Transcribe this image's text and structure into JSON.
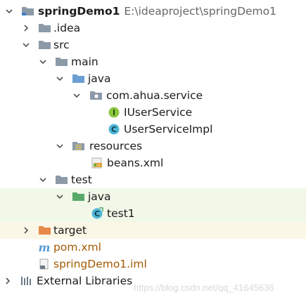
{
  "tree": {
    "project": {
      "name": "springDemo1",
      "path": "E:\\ideaproject\\springDemo1"
    },
    "idea": ".idea",
    "src": "src",
    "main": "main",
    "main_java": "java",
    "package": "com.ahua.service",
    "iuserservice": "IUserService",
    "userserviceimpl": "UserServiceImpl",
    "resources": "resources",
    "beans": "beans.xml",
    "test": "test",
    "test_java": "java",
    "test1": "test1",
    "target": "target",
    "pom": "pom.xml",
    "iml": "springDemo1.iml",
    "external": "External Libraries"
  },
  "watermark": "https://blog.csdn.net/qq_41645636",
  "colors": {
    "folder": "#8c9aa8",
    "source_folder": "#6a9fd1",
    "test_folder": "#59a869",
    "target_folder": "#e8894a",
    "interface_icon": "#8cc63f",
    "class_icon": "#50b6d6",
    "test_row_bg": "#f1f8e8",
    "target_row_bg": "#fbf7e6"
  }
}
